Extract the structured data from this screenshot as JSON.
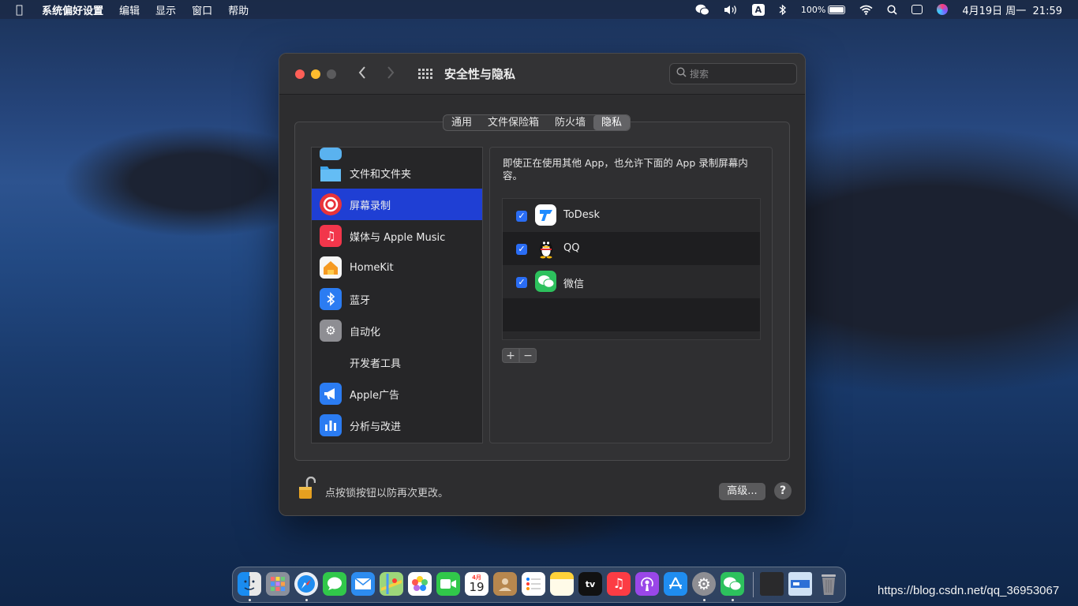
{
  "menubar": {
    "app_name": "系统偏好设置",
    "menus": [
      "编辑",
      "显示",
      "窗口",
      "帮助"
    ],
    "battery": "100%",
    "input_source": "A",
    "datetime": "4月19日 周一  21:59"
  },
  "window": {
    "title": "安全性与隐私",
    "search_placeholder": "搜索",
    "tabs": [
      "通用",
      "文件保险箱",
      "防火墙",
      "隐私"
    ],
    "selected_tab": "隐私",
    "sidebar": [
      {
        "label": "文件和文件夹",
        "icon": "folder-icon",
        "selected": false
      },
      {
        "label": "屏幕录制",
        "icon": "screen-recording-icon",
        "selected": true
      },
      {
        "label": "媒体与 Apple Music",
        "icon": "music-note-icon",
        "selected": false
      },
      {
        "label": "HomeKit",
        "icon": "home-icon",
        "selected": false
      },
      {
        "label": "蓝牙",
        "icon": "bluetooth-icon",
        "selected": false
      },
      {
        "label": "自动化",
        "icon": "gear-icon",
        "selected": false
      },
      {
        "label": "开发者工具",
        "icon": "",
        "selected": false
      },
      {
        "label": "Apple广告",
        "icon": "megaphone-icon",
        "selected": false
      },
      {
        "label": "分析与改进",
        "icon": "bar-chart-icon",
        "selected": false
      }
    ],
    "description": "即使正在使用其他 App，也允许下面的 App 录制屏幕内容。",
    "apps": [
      {
        "name": "ToDesk",
        "checked": true,
        "icon": "todesk-icon"
      },
      {
        "name": "QQ",
        "checked": true,
        "icon": "qq-penguin-icon"
      },
      {
        "name": "微信",
        "checked": true,
        "icon": "wechat-icon"
      }
    ],
    "add_label": "+",
    "remove_label": "−",
    "lock_message": "点按锁按钮以防再次更改。",
    "advanced_label": "高级...",
    "help_label": "?"
  },
  "dock": {
    "apps": [
      "Finder",
      "Launchpad",
      "Safari",
      "Messages",
      "Mail",
      "Maps",
      "Photos",
      "FaceTime",
      "Calendar",
      "Contacts",
      "Reminders",
      "Notes",
      "TV",
      "Music",
      "Podcasts",
      "App Store",
      "System Preferences",
      "WeChat"
    ],
    "calendar_month": "4月",
    "calendar_day": "19",
    "tv_label": "tv"
  },
  "watermark": "https://blog.csdn.net/qq_36953067",
  "colors": {
    "accent": "#1f3fd4",
    "checkbox": "#2a6df4",
    "wechat": "#2dc15d"
  }
}
